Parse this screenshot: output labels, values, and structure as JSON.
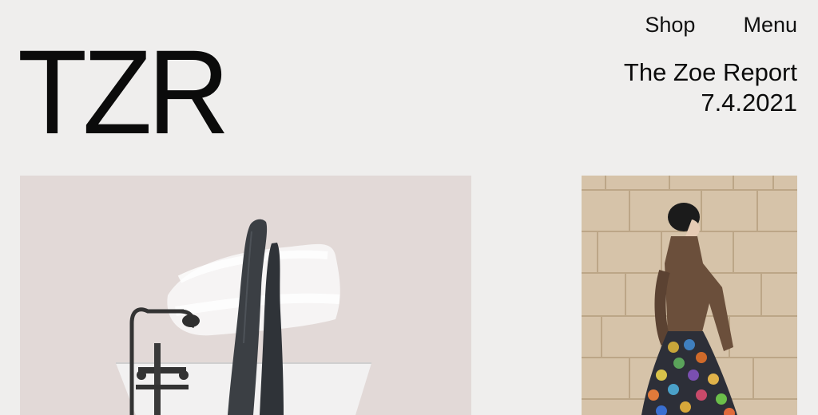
{
  "brand": {
    "logo_text": "TZR"
  },
  "nav": {
    "shop_label": "Shop",
    "menu_label": "Menu"
  },
  "masthead": {
    "title": "The Zoe Report",
    "date": "7.4.2021"
  },
  "colors": {
    "background": "#efeeed",
    "text": "#0b0b0b",
    "card_main_bg": "#e2d9d7",
    "card_side_bg": "#d8c6ad"
  },
  "images": {
    "main": {
      "depicts": "legs-in-bathtub-illustration"
    },
    "side": {
      "depicts": "model-walking-in-sequin-skirt"
    }
  }
}
